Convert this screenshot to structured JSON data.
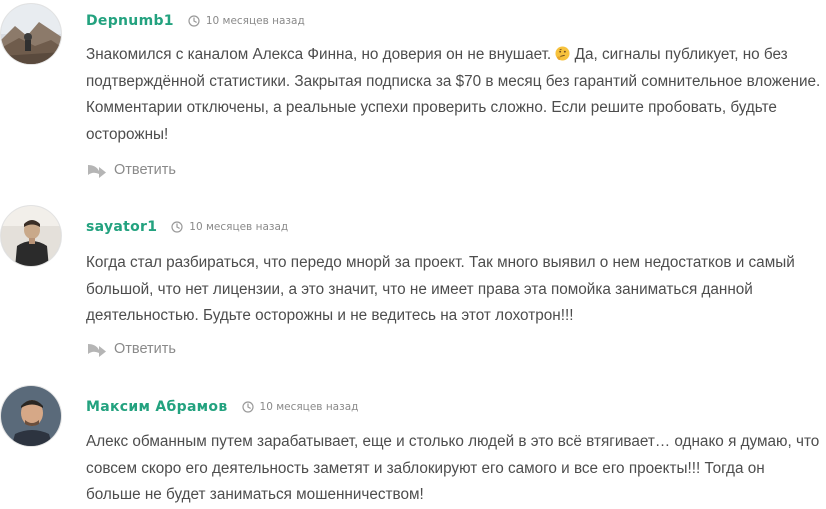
{
  "comments": [
    {
      "author": "Depnumb1",
      "date": "10 месяцев назад",
      "text_before_emoji": "Знакомился с каналом Алекса Финна, но доверия он не внушает. ",
      "text_after_emoji": " Да, сигналы публикует, но без подтверждённой статистики. Закрытая подписка за $70 в месяц без гарантий сомнительное вложение. Комментарии отключены, а реальные успехи проверить сложно. Если решите пробовать, будьте осторожны!",
      "emoji": "thinking-face-icon",
      "reply_label": "Ответить",
      "avatar": "mountain-landscape-avatar"
    },
    {
      "author": "sayator1",
      "date": "10 месяцев назад",
      "text": "Когда стал разбираться, что передо мнорй за проект. Так много выявил о нем недостатков и самый большой, что нет лицензии, а это значит, что не имеет права эта помойка заниматься данной деятельностью. Будьте осторожны и не ведитесь на этот лохотрон!!!",
      "reply_label": "Ответить",
      "avatar": "person-dark-jacket-avatar"
    },
    {
      "author": "Максим Абрамов",
      "date": "10 месяцев назад",
      "text": "Алекс обманным путем зарабатывает, еще и столько людей в это всё втягивает… однако я думаю, что совсем скоро его деятельность заметят и заблокируют его самого и все его проекты!!! Тогда он больше не будет заниматься мошенничеством!",
      "avatar": "man-portrait-avatar"
    }
  ],
  "colors": {
    "author": "#23a27f",
    "text": "#4d4d4d",
    "muted": "#8a8a8a"
  }
}
